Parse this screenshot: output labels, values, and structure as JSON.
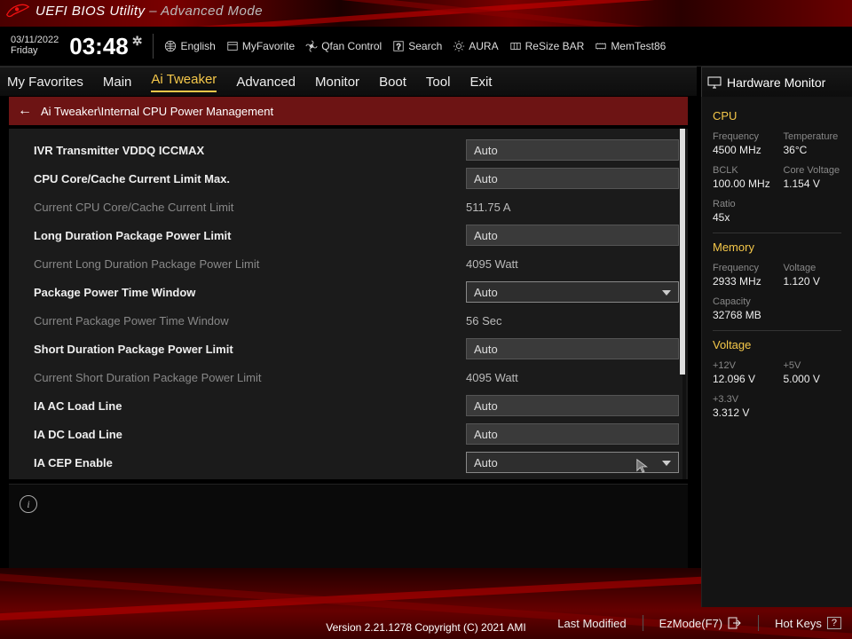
{
  "title": {
    "main": "UEFI BIOS Utility",
    "mode": "Advanced Mode"
  },
  "date": "03/11/2022",
  "day": "Friday",
  "clock": "03:48",
  "utilbar": {
    "language": "English",
    "favorite": "MyFavorite",
    "qfan": "Qfan Control",
    "search": "Search",
    "aura": "AURA",
    "resizebar": "ReSize BAR",
    "memtest": "MemTest86"
  },
  "nav": {
    "items": [
      "My Favorites",
      "Main",
      "Ai Tweaker",
      "Advanced",
      "Monitor",
      "Boot",
      "Tool",
      "Exit"
    ],
    "active_index": 2
  },
  "hwmon_title": "Hardware Monitor",
  "crumb": {
    "path": "Ai Tweaker\\Internal CPU Power Management"
  },
  "settings": [
    {
      "label": "IVR Transmitter VDDQ ICCMAX",
      "type": "text",
      "value": "Auto",
      "editable": true
    },
    {
      "label": "CPU Core/Cache Current Limit Max.",
      "type": "text",
      "value": "Auto",
      "editable": true
    },
    {
      "label": "Current CPU Core/Cache Current Limit",
      "type": "static",
      "value": "511.75 A",
      "editable": false
    },
    {
      "label": "Long Duration Package Power Limit",
      "type": "text",
      "value": "Auto",
      "editable": true
    },
    {
      "label": "Current Long Duration Package Power Limit",
      "type": "static",
      "value": "4095 Watt",
      "editable": false
    },
    {
      "label": "Package Power Time Window",
      "type": "select",
      "value": "Auto",
      "editable": true
    },
    {
      "label": "Current Package Power Time Window",
      "type": "static",
      "value": "56 Sec",
      "editable": false
    },
    {
      "label": "Short Duration Package Power Limit",
      "type": "text",
      "value": "Auto",
      "editable": true
    },
    {
      "label": "Current Short Duration Package Power Limit",
      "type": "static",
      "value": "4095 Watt",
      "editable": false
    },
    {
      "label": "IA AC Load Line",
      "type": "text",
      "value": "Auto",
      "editable": true
    },
    {
      "label": "IA DC Load Line",
      "type": "text",
      "value": "Auto",
      "editable": true
    },
    {
      "label": "IA CEP Enable",
      "type": "select",
      "value": "Auto",
      "editable": true
    }
  ],
  "hwmon": {
    "cpu": {
      "title": "CPU",
      "frequency": {
        "k": "Frequency",
        "v": "4500 MHz"
      },
      "temperature": {
        "k": "Temperature",
        "v": "36°C"
      },
      "bclk": {
        "k": "BCLK",
        "v": "100.00 MHz"
      },
      "corev": {
        "k": "Core Voltage",
        "v": "1.154 V"
      },
      "ratio": {
        "k": "Ratio",
        "v": "45x"
      }
    },
    "memory": {
      "title": "Memory",
      "frequency": {
        "k": "Frequency",
        "v": "2933 MHz"
      },
      "voltage": {
        "k": "Voltage",
        "v": "1.120 V"
      },
      "capacity": {
        "k": "Capacity",
        "v": "32768 MB"
      }
    },
    "voltage": {
      "title": "Voltage",
      "v12": {
        "k": "+12V",
        "v": "12.096 V"
      },
      "v5": {
        "k": "+5V",
        "v": "5.000 V"
      },
      "v33": {
        "k": "+3.3V",
        "v": "3.312 V"
      }
    }
  },
  "footer": {
    "last_modified": "Last Modified",
    "ezmode": "EzMode(F7)",
    "hotkeys": "Hot Keys",
    "hotkeys_key": "?",
    "version": "Version 2.21.1278 Copyright (C) 2021 AMI"
  }
}
